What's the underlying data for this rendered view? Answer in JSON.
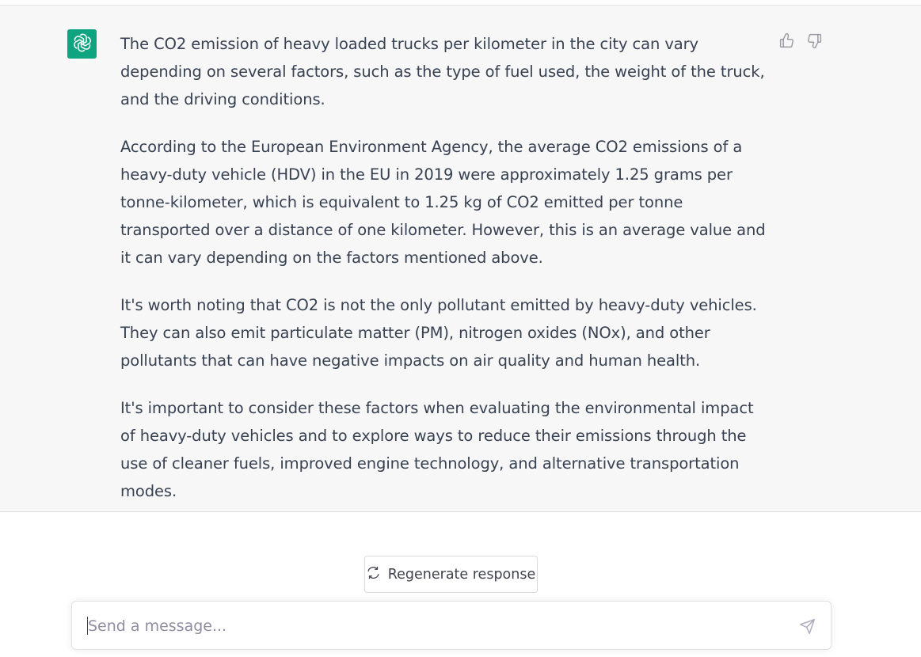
{
  "conversation": {
    "assistant_message": {
      "paragraphs": [
        "The CO2 emission of heavy loaded trucks per kilometer in the city can vary depending on several factors, such as the type of fuel used, the weight of the truck, and the driving conditions.",
        "According to the European Environment Agency, the average CO2 emissions of a heavy-duty vehicle (HDV) in the EU in 2019 were approximately 1.25 grams per tonne-kilometer, which is equivalent to 1.25 kg of CO2 emitted per tonne transported over a distance of one kilometer. However, this is an average value and it can vary depending on the factors mentioned above.",
        "It's worth noting that CO2 is not the only pollutant emitted by heavy-duty vehicles. They can also emit particulate matter (PM), nitrogen oxides (NOx), and other pollutants that can have negative impacts on air quality and human health.",
        "It's important to consider these factors when evaluating the environmental impact of heavy-duty vehicles and to explore ways to reduce their emissions through the use of cleaner fuels, improved engine technology, and alternative transportation modes."
      ],
      "avatar_icon": "openai-logo-icon",
      "feedback_icons": [
        "thumbs-up-icon",
        "thumbs-down-icon"
      ]
    }
  },
  "actions": {
    "regenerate_label": "Regenerate response",
    "regenerate_icon": "refresh-icon"
  },
  "composer": {
    "placeholder": "Send a message...",
    "value": "",
    "send_icon": "send-icon"
  },
  "colors": {
    "assistant_bg": "#f7f7f8",
    "avatar_bg": "#10a37f",
    "text": "#374151"
  }
}
